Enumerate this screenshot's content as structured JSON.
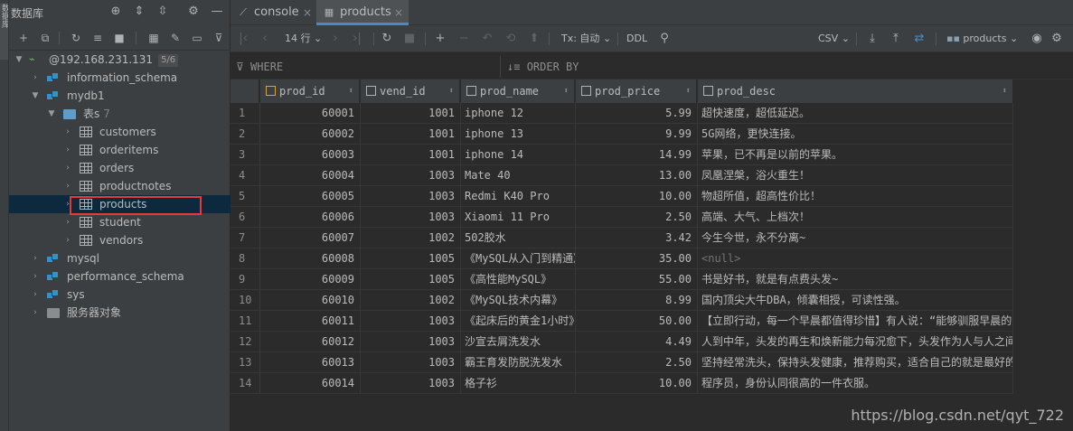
{
  "left_panel": {
    "strip_label": "数据库",
    "title": "数据库",
    "tree": [
      {
        "label": "@192.168.231.131",
        "badge": "5/6",
        "kind": "host",
        "level": 0,
        "expanded": true
      },
      {
        "label": "information_schema",
        "kind": "schema",
        "level": 1,
        "expanded": false
      },
      {
        "label": "mydb1",
        "kind": "schema",
        "level": 1,
        "expanded": true
      },
      {
        "label": "表s",
        "count": "7",
        "kind": "folder",
        "level": 2,
        "expanded": true
      },
      {
        "label": "customers",
        "kind": "table",
        "level": 3
      },
      {
        "label": "orderitems",
        "kind": "table",
        "level": 3
      },
      {
        "label": "orders",
        "kind": "table",
        "level": 3
      },
      {
        "label": "productnotes",
        "kind": "table",
        "level": 3
      },
      {
        "label": "products",
        "kind": "table",
        "level": 3,
        "selected": true
      },
      {
        "label": "student",
        "kind": "table",
        "level": 3
      },
      {
        "label": "vendors",
        "kind": "table",
        "level": 3
      },
      {
        "label": "mysql",
        "kind": "schema",
        "level": 1,
        "expanded": false
      },
      {
        "label": "performance_schema",
        "kind": "schema",
        "level": 1,
        "expanded": false
      },
      {
        "label": "sys",
        "kind": "schema",
        "level": 1,
        "expanded": false
      },
      {
        "label": "服务器对象",
        "kind": "server",
        "level": 1,
        "expanded": false
      }
    ]
  },
  "tabs": [
    {
      "label": "console",
      "icon": "console-icon",
      "active": false
    },
    {
      "label": "products",
      "icon": "table-icon",
      "active": true
    }
  ],
  "toolbar": {
    "rows_label": "14 行",
    "tx_label": "Tx: 自动",
    "ddl_label": "DDL",
    "export_format": "CSV",
    "target_label": "products"
  },
  "filter": {
    "where_label": "WHERE",
    "orderby_label": "ORDER BY"
  },
  "columns": [
    "prod_id",
    "vend_id",
    "prod_name",
    "prod_price",
    "prod_desc"
  ],
  "rows": [
    [
      "1",
      "60001",
      "1001",
      "iphone 12",
      "5.99",
      "超快速度，超低延迟。"
    ],
    [
      "2",
      "60002",
      "1001",
      "iphone 13",
      "9.99",
      "5G网络，更快连接。"
    ],
    [
      "3",
      "60003",
      "1001",
      "iphone 14",
      "14.99",
      "苹果，已不再是以前的苹果。"
    ],
    [
      "4",
      "60004",
      "1003",
      "Mate 40",
      "13.00",
      "凤凰涅槃，浴火重生！"
    ],
    [
      "5",
      "60005",
      "1003",
      "Redmi K40 Pro",
      "10.00",
      "物超所值，超高性价比！"
    ],
    [
      "6",
      "60006",
      "1003",
      "Xiaomi 11 Pro",
      "2.50",
      "高端、大气、上档次！"
    ],
    [
      "7",
      "60007",
      "1002",
      "502胶水",
      "3.42",
      "今生今世，永不分离~"
    ],
    [
      "8",
      "60008",
      "1005",
      "《MySQL从入门到精通》",
      "35.00",
      "<null>"
    ],
    [
      "9",
      "60009",
      "1005",
      "《高性能MySQL》",
      "55.00",
      "书是好书，就是有点费头发~"
    ],
    [
      "10",
      "60010",
      "1002",
      "《MySQL技术内幕》",
      "8.99",
      "国内顶尖大牛DBA，倾囊相授，可读性强。"
    ],
    [
      "11",
      "60011",
      "1003",
      "《起床后的黄金1小时》",
      "50.00",
      "【立即行动，每一个早晨都值得珍惜】有人说：“能够驯服早晨的人"
    ],
    [
      "12",
      "60012",
      "1003",
      "沙宣去屑洗发水",
      "4.49",
      "人到中年，头发的再生和焕新能力每况愈下，头发作为人与人之间"
    ],
    [
      "13",
      "60013",
      "1003",
      "霸王育发防脱洗发水",
      "2.50",
      "坚持经常洗头，保持头发健康，推荐购买，适合自己的就是最好的"
    ],
    [
      "14",
      "60014",
      "1003",
      "格子衫",
      "10.00",
      "程序员，身份认同很高的一件衣服。"
    ]
  ],
  "watermark": "https://blog.csdn.net/qyt_722"
}
